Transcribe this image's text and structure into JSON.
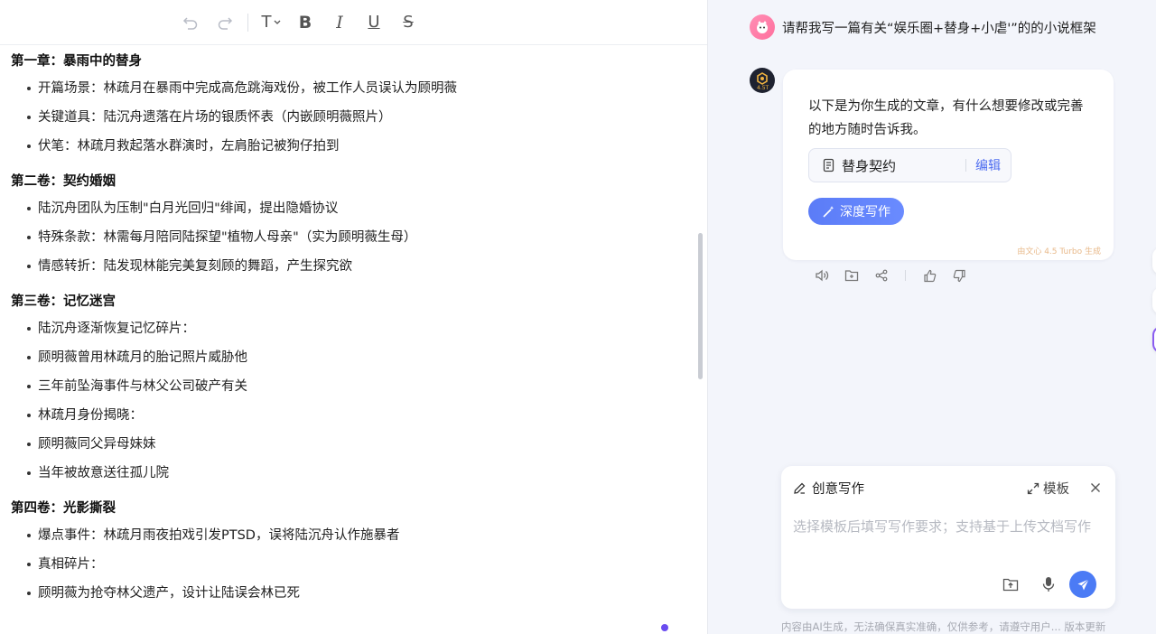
{
  "toolbar": {
    "undo": "undo-icon",
    "redo": "redo-icon",
    "text_style": "T",
    "bold": "B",
    "italic": "I",
    "underline": "U",
    "strikethrough": "S"
  },
  "document": {
    "sections": [
      {
        "title": "第一章：暴雨中的替身",
        "items": [
          "开篇场景：林疏月在暴雨中完成高危跳海戏份，被工作人员误认为顾明薇",
          "关键道具：陆沉舟遗落在片场的银质怀表（内嵌顾明薇照片）",
          "伏笔：林疏月救起落水群演时，左肩胎记被狗仔拍到"
        ]
      },
      {
        "title": "第二卷：契约婚姻",
        "items": [
          "陆沉舟团队为压制\"白月光回归\"绯闻，提出隐婚协议",
          "特殊条款：林需每月陪同陆探望\"植物人母亲\"（实为顾明薇生母）",
          "情感转折：陆发现林能完美复刻顾的舞蹈，产生探究欲"
        ]
      },
      {
        "title": "第三卷：记忆迷宫",
        "items": [
          "陆沉舟逐渐恢复记忆碎片：",
          "顾明薇曾用林疏月的胎记照片威胁他",
          "三年前坠海事件与林父公司破产有关",
          "林疏月身份揭晓：",
          "顾明薇同父异母妹妹",
          "当年被故意送往孤儿院"
        ]
      },
      {
        "title": "第四卷：光影撕裂",
        "items": [
          "爆点事件：林疏月雨夜拍戏引发PTSD，误将陆沉舟认作施暴者",
          "真相碎片：",
          "顾明薇为抢夺林父遗产，设计让陆误会林已死"
        ]
      }
    ]
  },
  "chat": {
    "user_message": "请帮我写一篇有关“娱乐圈+替身+小虐'”的的小说框架",
    "bot_badge": "4.5T",
    "bot_message": "以下是为你生成的文章，有什么想要修改或完善的地方随时告诉我。",
    "doc_card_title": "替身契约",
    "doc_card_edit": "编辑",
    "deep_write_label": "深度写作",
    "generated_by": "由文心 4.5 Turbo 生成"
  },
  "composer": {
    "mode_label": "创意写作",
    "template_label": "模板",
    "placeholder": "选择模板后填写写作要求；支持基于上传文档写作"
  },
  "footer": {
    "note": "内容由AI生成，无法确保真实准确，仅供参考，请遵守用户...  版本更新"
  },
  "colors": {
    "accent": "#4b7bf5",
    "panel_bg": "#f3f5fb",
    "link": "#4d6cf0"
  }
}
